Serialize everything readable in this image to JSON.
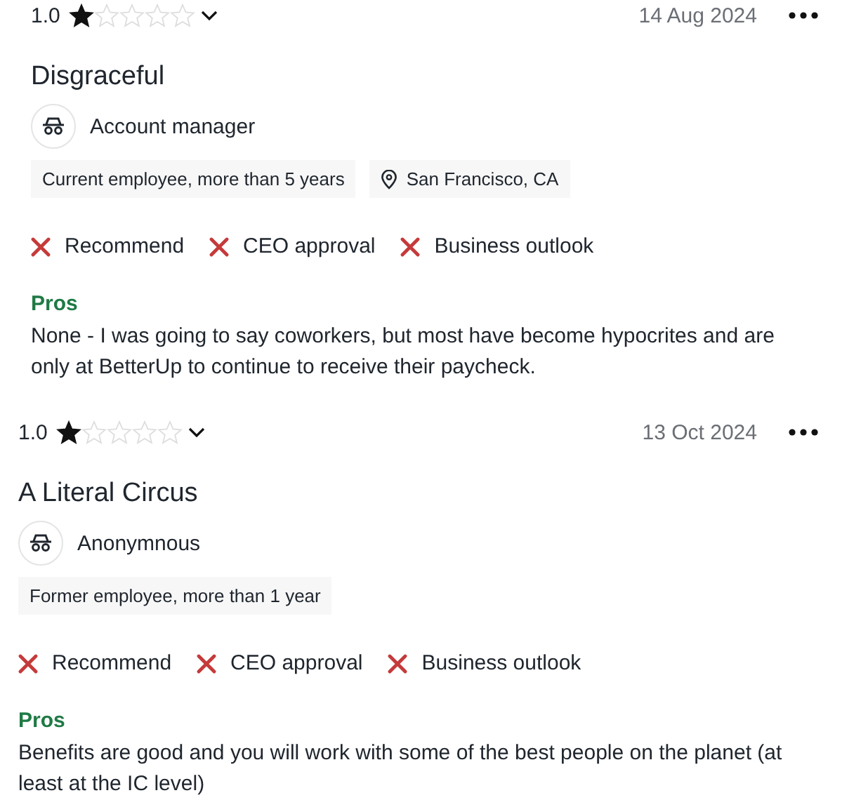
{
  "reviews": [
    {
      "rating": "1.0",
      "stars": 1,
      "date": "14 Aug 2024",
      "title": "Disgraceful",
      "author": "Account manager",
      "tags": [
        {
          "kind": "status",
          "text": "Current employee, more than 5 years"
        },
        {
          "kind": "location",
          "text": "San Francisco, CA"
        }
      ],
      "verdicts": [
        {
          "kind": "negative",
          "label": "Recommend"
        },
        {
          "kind": "negative",
          "label": "CEO approval"
        },
        {
          "kind": "negative",
          "label": "Business outlook"
        }
      ],
      "pros_label": "Pros",
      "pros": "None - I was going to say coworkers, but most have become hypocrites and are only at BetterUp to continue to receive their paycheck."
    },
    {
      "rating": "1.0",
      "stars": 1,
      "date": "13 Oct 2024",
      "title": "A Literal Circus",
      "author": "Anonymnous",
      "tags": [
        {
          "kind": "status",
          "text": "Former employee, more than 1 year"
        }
      ],
      "verdicts": [
        {
          "kind": "negative",
          "label": "Recommend"
        },
        {
          "kind": "negative",
          "label": "CEO approval"
        },
        {
          "kind": "negative",
          "label": "Business outlook"
        }
      ],
      "pros_label": "Pros",
      "pros": "Benefits are good and you will work with some of the best people on the planet (at least at the IC level)"
    }
  ]
}
